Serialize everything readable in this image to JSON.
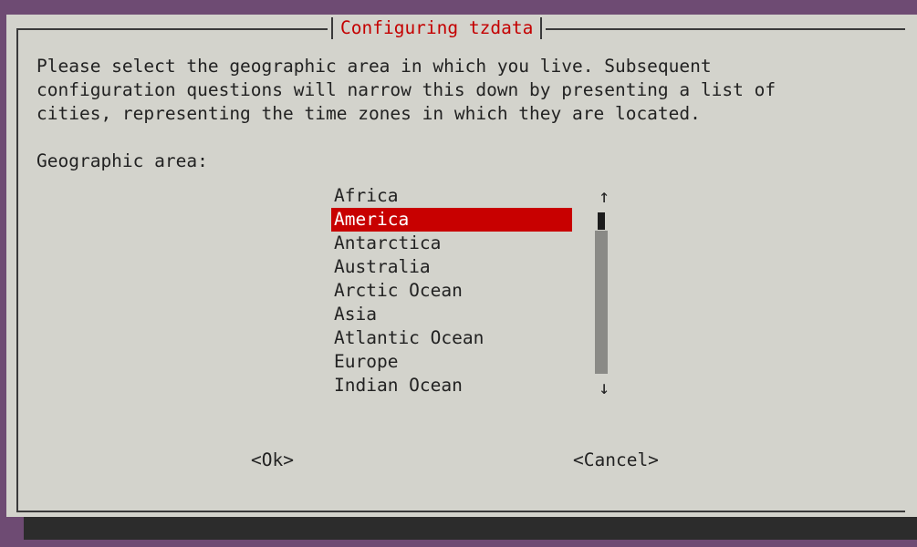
{
  "dialog": {
    "title": "Configuring tzdata",
    "prompt": "Please select the geographic area in which you live. Subsequent\nconfiguration questions will narrow this down by presenting a list of\ncities, representing the time zones in which they are located.",
    "area_label": "Geographic area:"
  },
  "list": {
    "items": [
      "Africa",
      "America",
      "Antarctica",
      "Australia",
      "Arctic Ocean",
      "Asia",
      "Atlantic Ocean",
      "Europe",
      "Indian Ocean"
    ],
    "selected": "America",
    "scroll_up_icon": "arrow-up-icon",
    "scroll_down_icon": "arrow-down-icon"
  },
  "buttons": {
    "ok_label": "<Ok>",
    "cancel_label": "<Cancel>"
  },
  "colors": {
    "desktop": "#6e4b73",
    "dialog_bg": "#d3d3cc",
    "title_red": "#c40000",
    "selection_red": "#c80000",
    "shadow": "#2c2c2c"
  }
}
